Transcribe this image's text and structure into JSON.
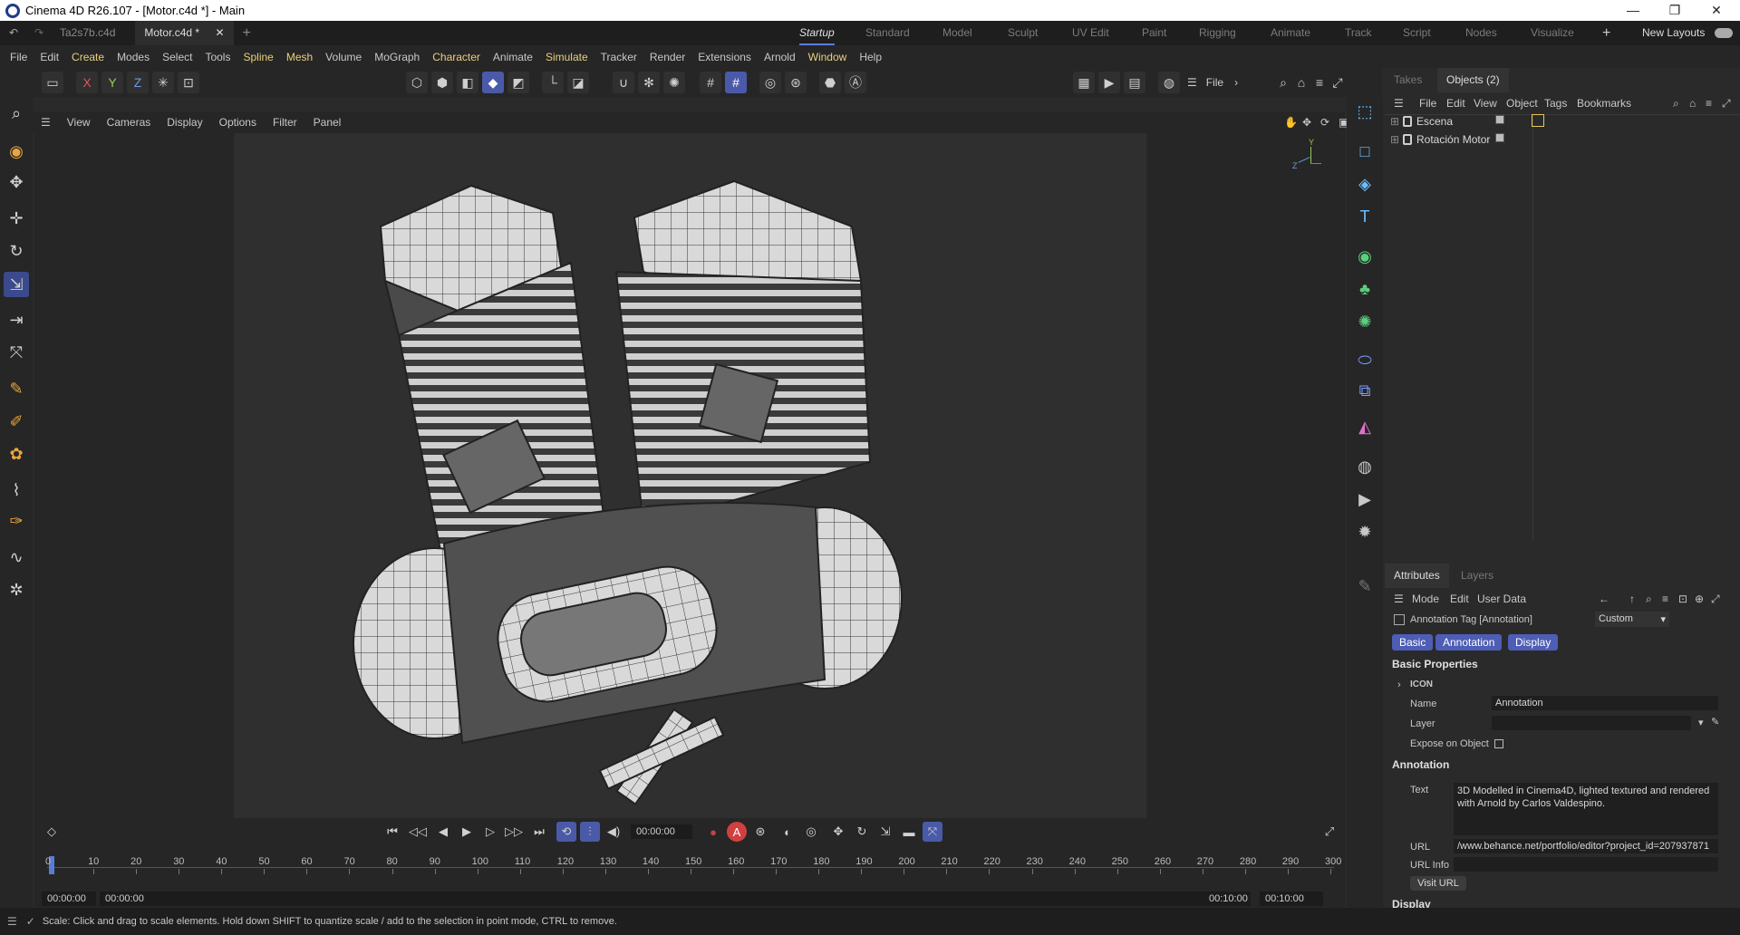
{
  "window": {
    "title": "Cinema 4D R26.107 - [Motor.c4d *] - Main"
  },
  "file_tabs": [
    {
      "label": "Ta2s7b.c4d"
    },
    {
      "label": "Motor.c4d *"
    }
  ],
  "layouts": {
    "items": [
      "Startup",
      "Standard",
      "Model",
      "Sculpt",
      "UV Edit",
      "Paint",
      "Rigging",
      "Animate",
      "Track",
      "Script",
      "Nodes",
      "Visualize"
    ],
    "new_label": "New Layouts"
  },
  "menu": [
    "File",
    "Edit",
    "Create",
    "Modes",
    "Select",
    "Tools",
    "Spline",
    "Mesh",
    "Volume",
    "MoGraph",
    "Character",
    "Animate",
    "Simulate",
    "Tracker",
    "Render",
    "Extensions",
    "Arnold",
    "Window",
    "Help"
  ],
  "toolbar": {
    "x": "X",
    "y": "Y",
    "z": "Z",
    "file_label": "File"
  },
  "viewport_menu": [
    "View",
    "Cameras",
    "Display",
    "Options",
    "Filter",
    "Panel"
  ],
  "axis": {
    "y": "Y",
    "z": "Z"
  },
  "object_panel": {
    "tabs": [
      "Takes",
      "Objects (2)"
    ],
    "menu": [
      "File",
      "Edit",
      "View",
      "Object",
      "Tags",
      "Bookmarks"
    ],
    "objects": [
      {
        "name": "Escena"
      },
      {
        "name": "Rotación Motor"
      }
    ]
  },
  "attributes": {
    "tabs": [
      "Attributes",
      "Layers"
    ],
    "menu": [
      "Mode",
      "Edit",
      "User Data"
    ],
    "header": "Annotation Tag [Annotation]",
    "preset": "Custom",
    "pills": [
      "Basic",
      "Annotation",
      "Display"
    ],
    "basic_title": "Basic Properties",
    "icon_label": "ICON",
    "name_label": "Name",
    "name_value": "Annotation",
    "layer_label": "Layer",
    "expose_label": "Expose on Object",
    "annotation_title": "Annotation",
    "text_label": "Text",
    "text_value": "3D Modelled in Cinema4D, lighted textured and rendered with Arnold by Carlos Valdespino.",
    "url_label": "URL",
    "url_value": "/www.behance.net/portfolio/editor?project_id=207937871",
    "url_info_label": "URL Info",
    "visit_url": "Visit URL",
    "display_title": "Display"
  },
  "timeline": {
    "ticks": [
      "0",
      "10",
      "20",
      "30",
      "40",
      "50",
      "60",
      "70",
      "80",
      "90",
      "100",
      "110",
      "120",
      "130",
      "140",
      "150",
      "160",
      "170",
      "180",
      "190",
      "200",
      "210",
      "220",
      "230",
      "240",
      "250",
      "260",
      "270",
      "280",
      "290",
      "300"
    ],
    "current": "00:00:00",
    "start": "00:00:00",
    "start2": "00:00:00",
    "end": "00:10:00",
    "end2": "00:10:00"
  },
  "status": "Scale: Click and drag to scale elements. Hold down SHIFT to quantize scale / add to the selection in point mode, CTRL to remove."
}
